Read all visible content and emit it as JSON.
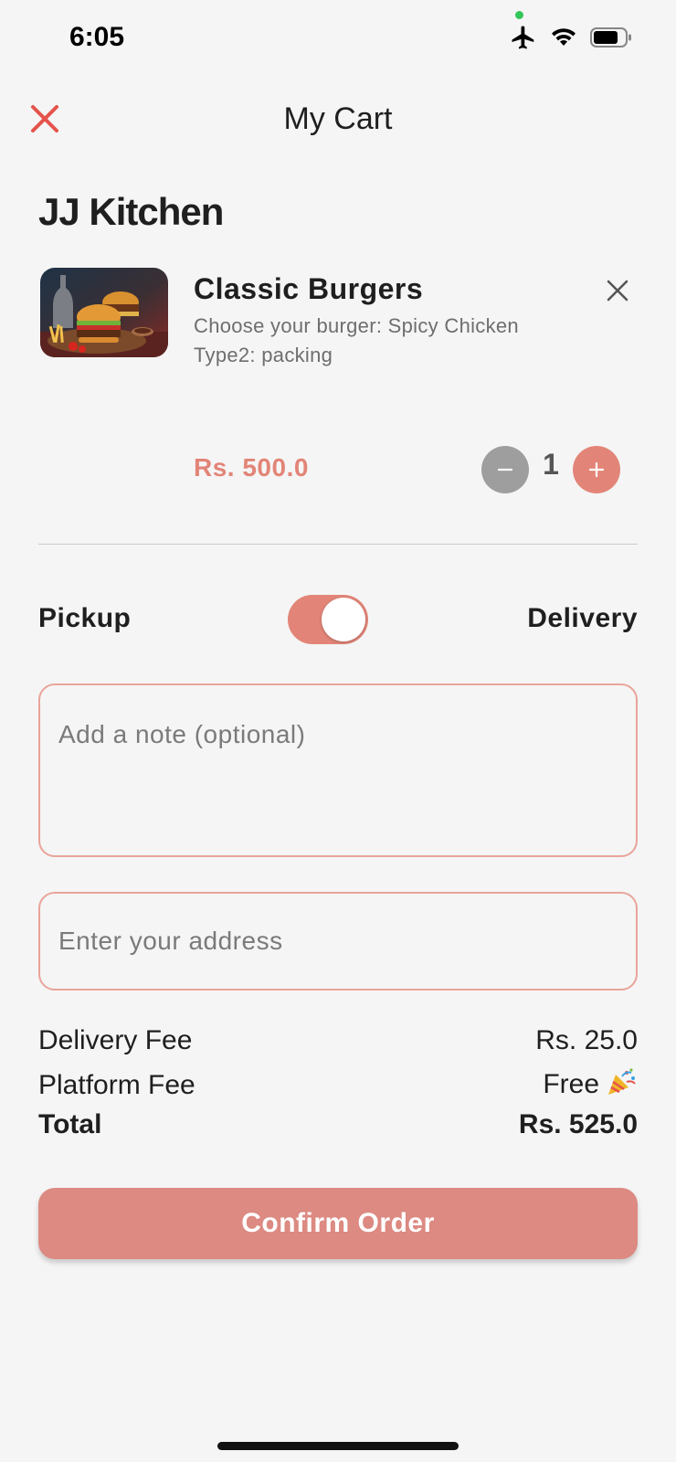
{
  "status_bar": {
    "time": "6:05",
    "icons": [
      "airplane-icon",
      "wifi-icon",
      "battery-icon"
    ]
  },
  "header": {
    "title": "My Cart",
    "close_icon": "close-icon"
  },
  "restaurant": {
    "name": "JJ Kitchen"
  },
  "cart_item": {
    "name": "Classic Burgers",
    "options": [
      "Choose your burger: Spicy Chicken",
      "Type2: packing"
    ],
    "price": "Rs. 500.0",
    "quantity": "1",
    "image_icon": "burger-image"
  },
  "order_mode": {
    "pickup_label": "Pickup",
    "delivery_label": "Delivery",
    "selected": "Delivery"
  },
  "inputs": {
    "note_placeholder": "Add a note (optional)",
    "note_value": "",
    "address_placeholder": "Enter your address",
    "address_value": ""
  },
  "summary": {
    "delivery_fee_label": "Delivery Fee",
    "delivery_fee_value": "Rs. 25.0",
    "platform_fee_label": "Platform Fee",
    "platform_fee_value": "Free",
    "total_label": "Total",
    "total_value": "Rs. 525.0"
  },
  "actions": {
    "confirm_label": "Confirm Order"
  },
  "colors": {
    "accent": "#e28578",
    "button": "#dc8a82",
    "border": "#e9a49a",
    "close": "#e5534b",
    "background": "#f5f5f5"
  }
}
